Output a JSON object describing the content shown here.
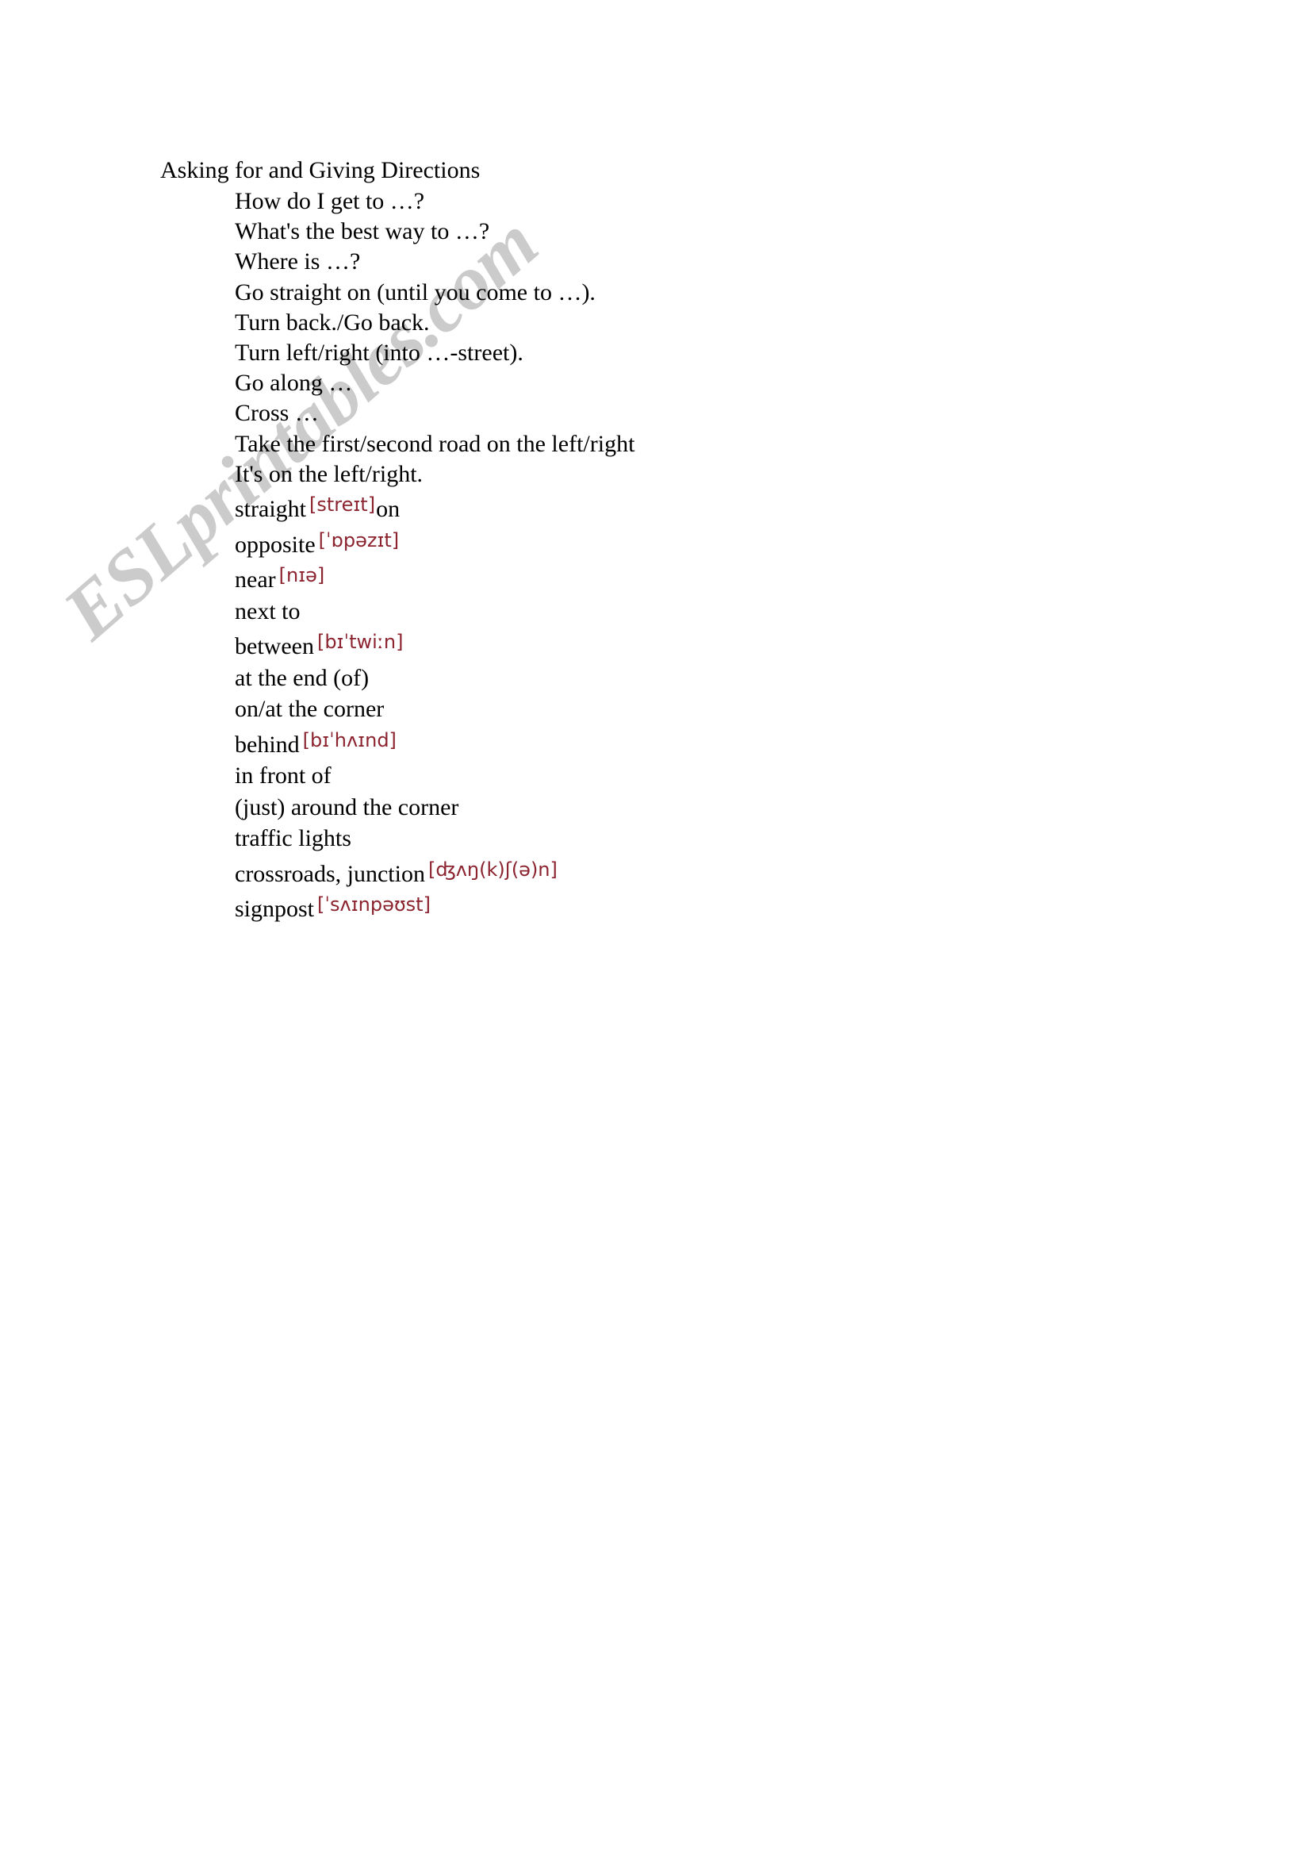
{
  "document": {
    "title": "Asking for and Giving Directions",
    "watermark": "ESLprintables.com",
    "ipa_color": "#8c2430",
    "text_color": "#000000",
    "background_color": "#ffffff"
  },
  "phrases": [
    {
      "text": "How do I get to …?"
    },
    {
      "text": "What's the best way to …?"
    },
    {
      "text": "Where is …?"
    },
    {
      "text": "Go straight on (until you come to …)."
    },
    {
      "text": "Turn back./Go back."
    },
    {
      "text": "Turn left/right (into …-street)."
    },
    {
      "text": "Go along …"
    },
    {
      "text": "Cross …"
    },
    {
      "text": "Take the first/second road on the left/right"
    },
    {
      "text": "It's on the left/right."
    }
  ],
  "vocabulary": [
    {
      "term": "straight",
      "ipa": "[streɪt]",
      "suffix": "on"
    },
    {
      "term": "opposite",
      "ipa": "[ˈɒpəzɪt]",
      "suffix": ""
    },
    {
      "term": "near",
      "ipa": "[nɪə]",
      "suffix": ""
    },
    {
      "term": "next to",
      "ipa": "",
      "suffix": ""
    },
    {
      "term": "between",
      "ipa": "[bɪˈtwiːn]",
      "suffix": ""
    },
    {
      "term": "at the end (of)",
      "ipa": "",
      "suffix": ""
    },
    {
      "term": "on/at the corner",
      "ipa": "",
      "suffix": ""
    },
    {
      "term": "behind",
      "ipa": "[bɪˈhʌɪnd]",
      "suffix": ""
    },
    {
      "term": "in front of",
      "ipa": "",
      "suffix": ""
    },
    {
      "term": "(just) around the corner",
      "ipa": "",
      "suffix": ""
    },
    {
      "term": "traffic lights",
      "ipa": "",
      "suffix": ""
    },
    {
      "term": "crossroads, junction",
      "ipa": "[ʤʌŋ(k)ʃ(ə)n]",
      "suffix": ""
    },
    {
      "term": "signpost",
      "ipa": "[ˈsʌɪnpəʊst]",
      "suffix": ""
    }
  ]
}
